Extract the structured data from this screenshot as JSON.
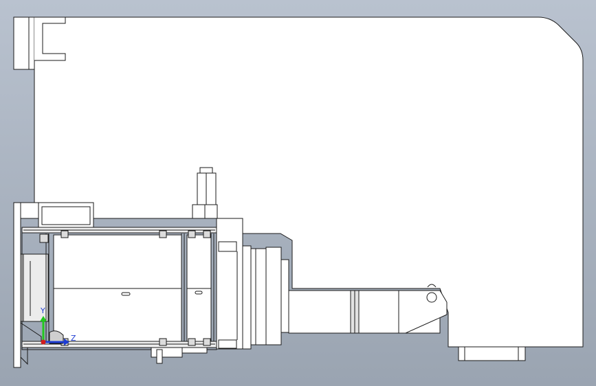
{
  "viewport": {
    "background_top": "#b9c2cf",
    "background_bottom": "#9aa4b1",
    "line_color": "#1a1a1a",
    "fill_color": "#ffffff",
    "shade_color": "#d8d8d8"
  },
  "triad": {
    "y_label": "Y",
    "z_label": "Z",
    "y_color": "#22c81e",
    "z_color": "#1e3cd2",
    "x_color": "#d21e1e"
  }
}
